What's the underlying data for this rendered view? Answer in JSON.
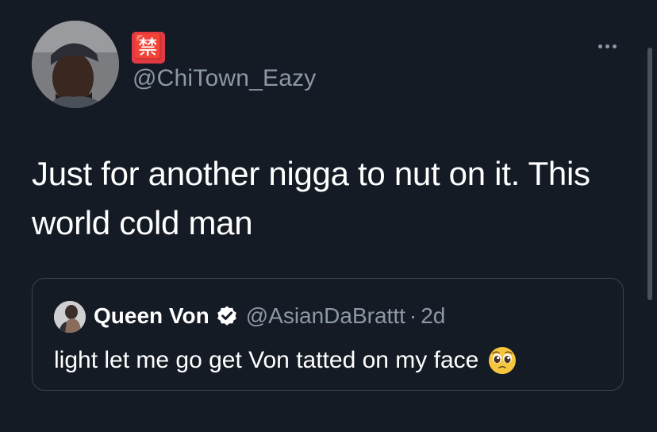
{
  "tweet": {
    "display_name": "🈲",
    "handle": "@ChiTown_Eazy",
    "text": "Just for another nigga to nut on it. This world cold man"
  },
  "quoted_tweet": {
    "name": "Queen Von",
    "handle": "@AsianDaBrattt",
    "separator": "·",
    "time": "2d",
    "text": "light let me go get Von tatted on my face",
    "emoji_icon": "pleading-face-icon"
  },
  "icons": {
    "more": "more-icon",
    "verified": "verified-badge-icon"
  },
  "colors": {
    "background": "#151b25",
    "text_primary": "#ffffff",
    "text_secondary": "#8b98a5",
    "border": "#38444d",
    "badge_red": "#e23a45"
  }
}
